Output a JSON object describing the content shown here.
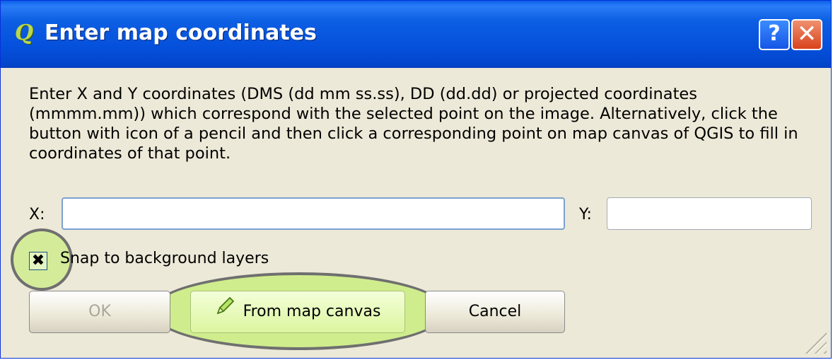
{
  "window": {
    "title": "Enter map coordinates",
    "help_label": "?",
    "close_label": "✕"
  },
  "instructions": "Enter X and Y coordinates (DMS (dd mm ss.ss), DD (dd.dd) or projected coordinates (mmmm.mm)) which correspond with the selected point on the image. Alternatively, click the button with icon of a pencil and then click a corresponding point on map canvas of QGIS to fill in coordinates of that point.",
  "fields": {
    "x_label": "X:",
    "x_value": "",
    "y_label": "Y:",
    "y_value": ""
  },
  "snap": {
    "label": "Snap to background layers",
    "checked": true,
    "mark": "✖"
  },
  "buttons": {
    "ok": "OK",
    "from_map_canvas": "From map canvas",
    "cancel": "Cancel"
  },
  "icons": {
    "app": "qgis-icon",
    "pencil": "pencil-icon"
  },
  "colors": {
    "titlebar": "#0550dc",
    "highlight": "#b8f050",
    "dialog_bg": "#ece9d8"
  }
}
